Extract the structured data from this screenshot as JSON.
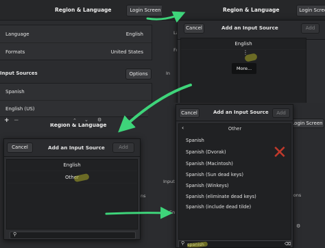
{
  "p1": {
    "title": "Region & Language",
    "login_btn": "Login Screen",
    "language_label": "Language",
    "language_value": "English",
    "formats_label": "Formats",
    "formats_value": "United States",
    "input_sources_label": "Input Sources",
    "options_btn": "Options",
    "sources": [
      "Spanish",
      "English (US)"
    ],
    "add_sym": "+",
    "remove_sym": "−"
  },
  "p2": {
    "title": "Region & Language",
    "login_btn": "Login Screen",
    "cancel_btn": "Cancel",
    "dialog_title": "Add an Input Source",
    "add_btn": "Add",
    "english_item": "English",
    "more_label": "More...",
    "ghost_la": "La",
    "ghost_fo": "Fo",
    "ghost_in": "In"
  },
  "p3": {
    "title": "Region & Language",
    "cancel_btn": "Cancel",
    "dialog_title": "Add an Input Source",
    "add_btn": "Add",
    "english_item": "English",
    "other_item": "Other",
    "ghost_ns": "ns"
  },
  "p4": {
    "login_btn": "Login Screen",
    "cancel_btn": "Cancel",
    "dialog_title": "Add an Input Source",
    "add_btn": "Add",
    "header": "Other",
    "items": [
      "Spanish",
      "Spanish (Dvorak)",
      "Spanish (Macintosh)",
      "Spanish (Sun dead keys)",
      "Spanish (Winkeys)",
      "Spanish (eliminate dead keys)",
      "Spanish (include dead tilde)"
    ],
    "search_value": "spanish",
    "ghost_input": "Input",
    "ghost_en": "En",
    "ghost_ions": "ions"
  },
  "colors": {
    "arrow": "#3ed47a",
    "reject_mark": "#c0392b",
    "highlight": "#a8a832"
  }
}
